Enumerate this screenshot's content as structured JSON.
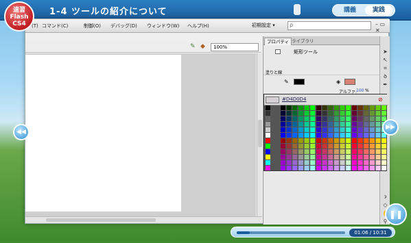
{
  "header": {
    "badge_lines": [
      "速習",
      "Flash",
      "CS4"
    ],
    "lesson_title": "1-4 ツールの紹介について",
    "seg_left": "講義",
    "seg_right": "実践"
  },
  "menu": {
    "items": [
      "ト(T)",
      "コマンド(C)",
      "制御(O)",
      "デバッグ(D)",
      "ウィンドウ(W)",
      "ヘルプ(H)"
    ],
    "workspace": "初期設定 ▾",
    "search_icon": "ρ"
  },
  "stage": {
    "zoom": "100%"
  },
  "panel": {
    "tabs": [
      "プロパティ",
      "ライブラリ"
    ],
    "tool_name": "矩形ツール",
    "section": "塗りと線",
    "alpha_label": "アルファ:",
    "alpha_value": "100",
    "alpha_unit": "%",
    "hex_value": "#D4D0D4"
  },
  "player": {
    "progress": 0.12,
    "time": "01:06 / 10:31"
  },
  "colors": {
    "accent": "#1a5d9c",
    "badge": "#c01d22"
  },
  "icons": [
    "prev-icon",
    "next-icon",
    "pause-icon",
    "arrow-tool-icon",
    "pencil-icon",
    "paint-bucket-icon",
    "eraser-icon",
    "zoom-tool-icon"
  ]
}
